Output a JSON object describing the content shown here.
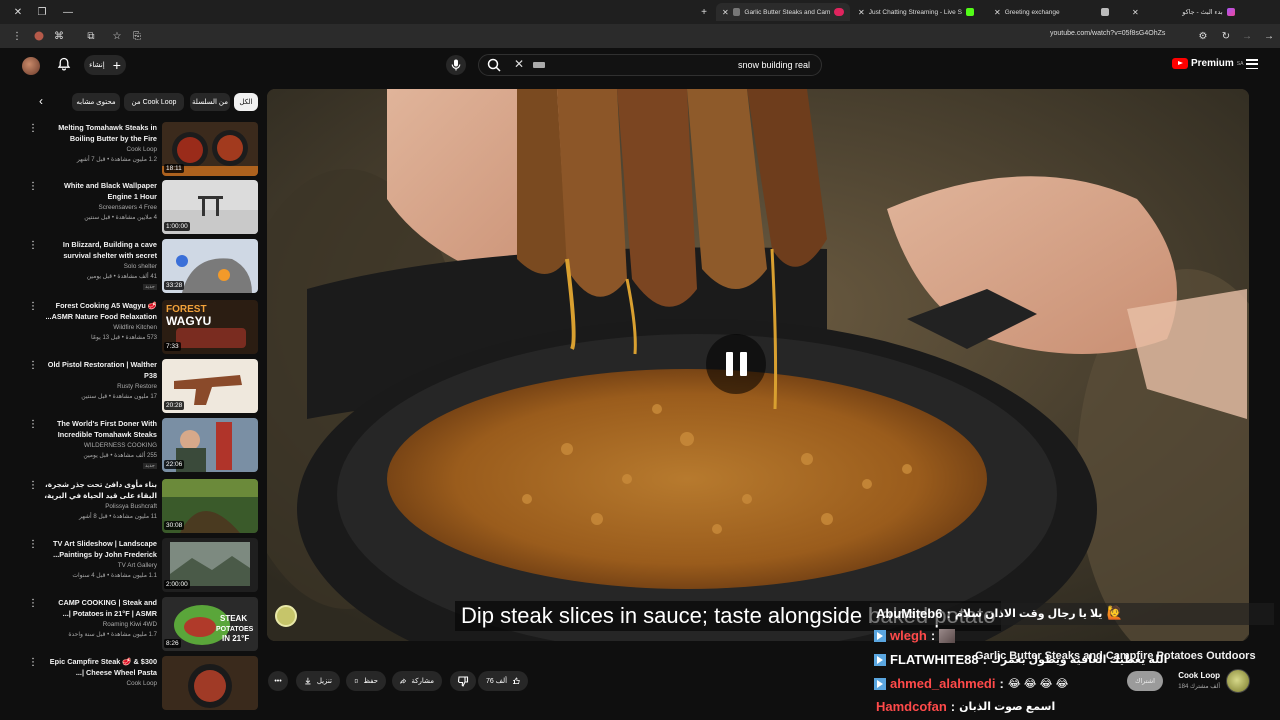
{
  "browser": {
    "tabs": [
      {
        "label": "Garlic Butter Steaks and Cam",
        "active": true
      },
      {
        "label": "Just Chatting Streaming - Live S",
        "active": false
      },
      {
        "label": "Greeting exchange",
        "active": false
      },
      {
        "label": "بدء البث - جاكو",
        "active": false
      }
    ],
    "url": "youtube.com/watch?v=05f8sG4OhZs"
  },
  "header": {
    "create_label": "إنشاء",
    "search_query": "snow building real",
    "logo_text": "Premium",
    "logo_region": "SA"
  },
  "chips": {
    "all": "الكل",
    "series": "من السلسلة",
    "channel": "من Cook Loop",
    "similar": "محتوى مشابه"
  },
  "related": [
    {
      "title": "Melting Tomahawk Steaks in Boiling Butter by the Fire",
      "channel": "Cook Loop",
      "meta": "1.2 مليون مشاهدة • قبل 7 أشهر",
      "duration": "18:11",
      "thumb": "steak_fire"
    },
    {
      "title": "White and Black Wallpaper Engine 1 Hour",
      "channel": "Screensavers 4 Free",
      "meta": "4 ملايين مشاهدة • قبل سنتين",
      "duration": "1:00:00",
      "thumb": "snow_gate"
    },
    {
      "title": "In Blizzard, Building a cave survival shelter with secret door...",
      "channel": "Solo shelter",
      "meta": "41 ألف مشاهدة • قبل يومين",
      "duration": "33:28",
      "thumb": "snow_cave",
      "badge": "جديد"
    },
    {
      "title": "Forest Cooking A5 Wagyu 🥩 ASMR Nature Food Relaxation...",
      "channel": "Wildfire Kitchen",
      "meta": "573 مشاهدة • قبل 13 يومًا",
      "duration": "7:33",
      "thumb": "wagyu"
    },
    {
      "title": "Old Pistol Restoration | Walther P38",
      "channel": "Rusty Restore",
      "meta": "17 مليون مشاهدة • قبل سنتين",
      "duration": "20:28",
      "thumb": "pistol"
    },
    {
      "title": "The World's First Doner With Incredible Tomahawk Steaks",
      "channel": "WILDERNESS COOKING",
      "meta": "255 ألف مشاهدة • قبل يومين",
      "duration": "22:06",
      "thumb": "doner",
      "badge": "جديد"
    },
    {
      "title": "بناء مأوى دافئ تحت جذر شجرة، البقاء على قيد الحياة في البرية، في الغابة",
      "channel": "Polissya Bushcraft",
      "meta": "11 مليون مشاهدة • قبل 8 أشهر",
      "duration": "30:08",
      "thumb": "shelter"
    },
    {
      "title": "TV Art Slideshow | Landscape Paintings by John Frederick...",
      "channel": "TV Art Gallery",
      "meta": "1.1 مليون مشاهدة • قبل 4 سنوات",
      "duration": "2:00:00",
      "thumb": "painting"
    },
    {
      "title": "CAMP COOKING | Steak and Potatoes in 21°F | ASMR |...",
      "channel": "Roaming Kiwi 4WD",
      "meta": "1.7 مليون مشاهدة • قبل سنة واحدة",
      "duration": "8:26",
      "thumb": "steak_potato"
    },
    {
      "title": "Epic Campfire Steak 🥩 & $300 Cheese Wheel Pasta |...",
      "channel": "Cook Loop",
      "meta": "",
      "duration": "",
      "thumb": "campfire_steak"
    }
  ],
  "video": {
    "subtitle": "Dip steak slices in sauce; taste alongside baked potato",
    "title": "Garlic Butter Steaks and Campfire Potatoes Outdoors"
  },
  "chat": [
    {
      "user": "AbuMiteb6",
      "text": "يلا يا رجال وقت الاذان سلام",
      "emote": "🙋",
      "color": "#ffffff"
    },
    {
      "user": "wlegh",
      "text": "",
      "emote": "",
      "color": "#ff4a4a"
    },
    {
      "user": "FLATWHITE88",
      "text": "الله يعطيك العافية ويطول بعمرك",
      "emote": "",
      "color": "#ffffff"
    },
    {
      "user": "ahmed_alahmedi",
      "text": "😂 😂 😂 😂",
      "emote": "",
      "color": "#ff4a4a"
    },
    {
      "user": "Hamdcofan",
      "text": "اسمع صوت الذبان",
      "emote": "",
      "color": "#ff4a4a"
    }
  ],
  "actions": {
    "likes": "76 ألف",
    "share": "مشاركة",
    "save": "حفظ",
    "download": "تنزيل"
  },
  "channel": {
    "name": "Cook Loop",
    "subscribers": "184 ألف مشترك",
    "subscribe_label": "اشتراك"
  }
}
